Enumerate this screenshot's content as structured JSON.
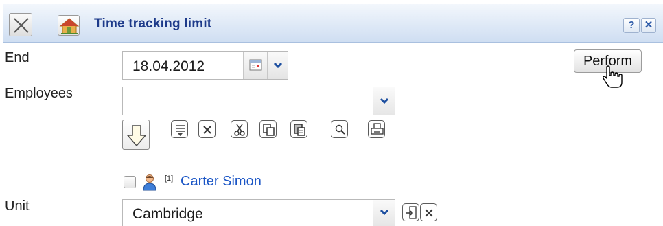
{
  "window": {
    "title": "Time tracking limit",
    "help_label": "?",
    "close_label": "✕"
  },
  "form": {
    "end": {
      "label": "End",
      "value": "18.04.2012"
    },
    "employees": {
      "label": "Employees",
      "value": "",
      "selected": [
        {
          "index": "[1]",
          "name": "Carter Simon",
          "checked": false
        }
      ]
    },
    "unit": {
      "label": "Unit",
      "value": "Cambridge"
    }
  },
  "actions": {
    "perform_label": "Perform"
  },
  "toolbar": {
    "items": [
      "move-down-icon",
      "list-icon",
      "remove-icon",
      "cut-icon",
      "copy-icon",
      "paste-icon",
      "search-icon",
      "print-icon"
    ]
  },
  "colors": {
    "title_text": "#1d3a8a",
    "link": "#1a55c5",
    "titlebar_bg": "#dde8f6"
  }
}
